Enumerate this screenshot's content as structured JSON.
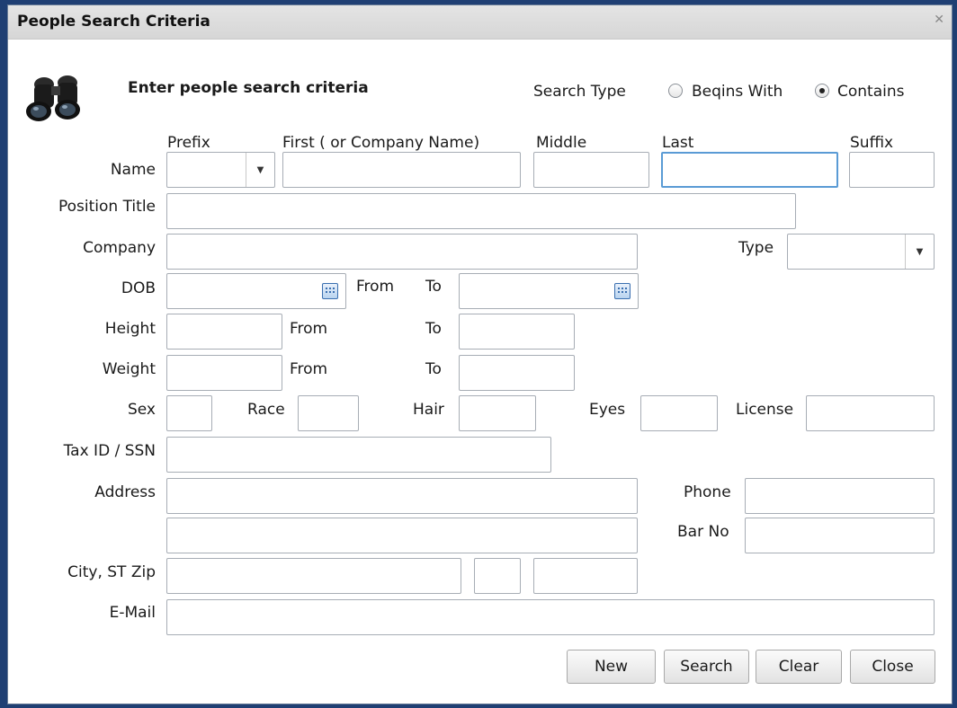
{
  "window": {
    "title": "People Search Criteria"
  },
  "header": {
    "heading": "Enter people search criteria",
    "search_type_label": "Search Type",
    "options": [
      "Beqins With",
      "Contains"
    ],
    "selected": "Contains"
  },
  "column_headers": {
    "prefix": "Prefix",
    "first": "First ( or Company Name)",
    "middle": "Middle",
    "last": "Last",
    "suffix": "Suffix"
  },
  "labels": {
    "name": "Name",
    "position_title": "Position Title",
    "company": "Company",
    "type": "Type",
    "dob": "DOB",
    "from": "From",
    "to": "To",
    "height": "Height",
    "weight": "Weight",
    "sex": "Sex",
    "race": "Race",
    "hair": "Hair",
    "eyes": "Eyes",
    "license": "License",
    "tax_id": "Tax ID / SSN",
    "address": "Address",
    "phone": "Phone",
    "bar_no": "Bar No",
    "city_st_zip": "City, ST Zip",
    "email": "E-Mail"
  },
  "buttons": {
    "new": "New",
    "search": "Search",
    "clear": "Clear",
    "close": "Close"
  },
  "icons": {
    "window_close": "close-icon",
    "dropdown": "chevron-down-icon",
    "calendar": "calendar-icon",
    "header_image": "binoculars-icon"
  }
}
